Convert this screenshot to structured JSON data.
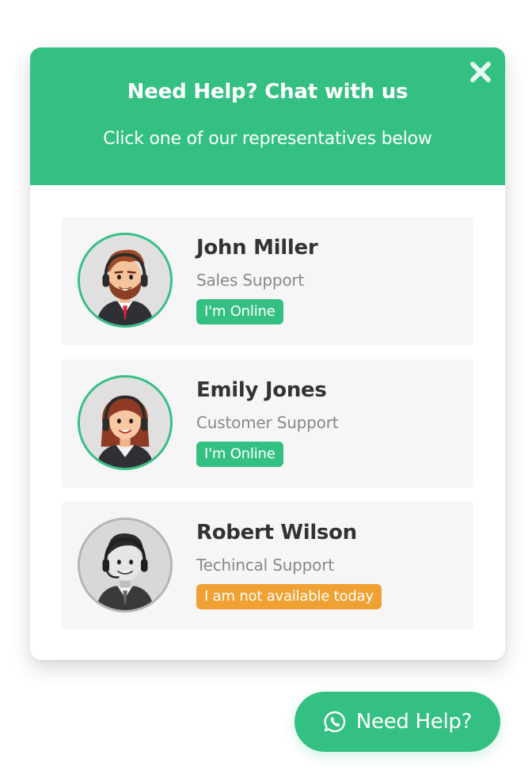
{
  "popup": {
    "title": "Need Help? Chat with us",
    "subtitle": "Click one of our representatives below",
    "close_icon": "close-icon"
  },
  "agents": [
    {
      "name": "John Miller",
      "role": "Sales Support",
      "status": "I'm Online",
      "status_type": "online",
      "avatar_icon": "male-agent-avatar"
    },
    {
      "name": "Emily Jones",
      "role": "Customer Support",
      "status": "I'm Online",
      "status_type": "online",
      "avatar_icon": "female-agent-avatar"
    },
    {
      "name": "Robert Wilson",
      "role": "Techincal Support",
      "status": "I am not available today",
      "status_type": "unavailable",
      "avatar_icon": "grayscale-agent-avatar"
    }
  ],
  "help_button": {
    "label": "Need Help?",
    "icon": "whatsapp-icon"
  },
  "colors": {
    "brand_green": "#34c082",
    "unavailable_orange": "#f0a133",
    "card_background": "#f6f6f6",
    "name_text": "#333333",
    "role_text": "#888888"
  }
}
